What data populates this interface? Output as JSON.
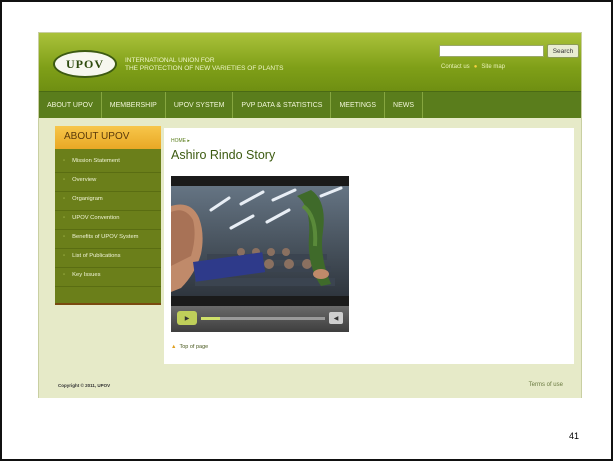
{
  "header": {
    "logo_text": "UPOV",
    "org_name_line1": "INTERNATIONAL UNION FOR",
    "org_name_line2": "THE PROTECTION OF NEW VARIETIES OF PLANTS",
    "search_placeholder": "",
    "search_button": "Search",
    "contact_link": "Contact us",
    "sitemap_link": "Site map"
  },
  "nav": {
    "items": [
      "ABOUT UPOV",
      "MEMBERSHIP",
      "UPOV SYSTEM",
      "PVP DATA & STATISTICS",
      "MEETINGS",
      "NEWS"
    ]
  },
  "sidebar": {
    "title": "ABOUT UPOV",
    "items": [
      "Mission Statement",
      "Overview",
      "Organigram",
      "UPOV Convention",
      "Benefits of UPOV System",
      "List of Publications",
      "Key Issues"
    ]
  },
  "content": {
    "breadcrumb": "HOME",
    "breadcrumb_arrow": "▸",
    "title": "Ashiro Rindo Story",
    "video_progress": 0.15,
    "top_link": "Top of page"
  },
  "footer": {
    "copyright": "Copyright © 2011, UPOV",
    "terms": "Terms of use"
  },
  "slide_number": "41",
  "colors": {
    "header_green": "#7f9f18",
    "nav_green": "#5a7d1c",
    "sidebar_green": "#6b7f1a",
    "sidebar_title": "#e9a825",
    "page_bg": "#e6eac8"
  }
}
